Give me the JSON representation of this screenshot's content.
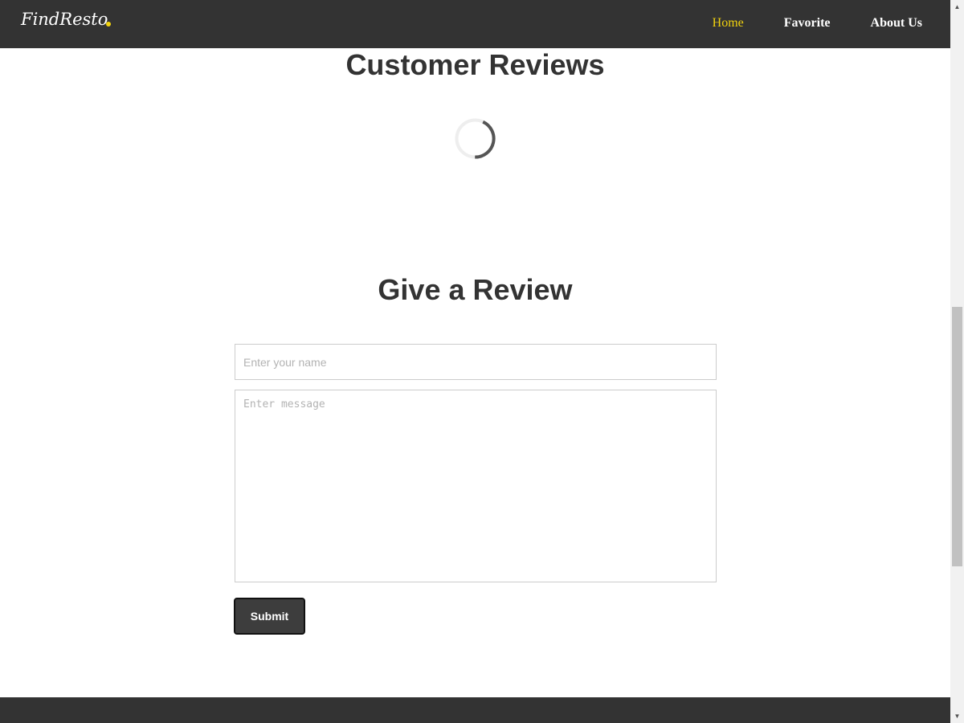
{
  "navbar": {
    "brand": "FindResto",
    "links": [
      {
        "label": "Home",
        "active": true
      },
      {
        "label": "Favorite",
        "active": false
      },
      {
        "label": "About Us",
        "active": false
      }
    ]
  },
  "reviews": {
    "title": "Customer Reviews"
  },
  "review_form": {
    "title": "Give a Review",
    "name_placeholder": "Enter your name",
    "name_value": "",
    "message_placeholder": "Enter message",
    "message_value": "",
    "submit_label": "Submit"
  },
  "icons": {
    "brand_dot": "dot-icon",
    "loader": "loading-spinner-icon",
    "scroll_up": "arrow-up-icon",
    "scroll_down": "arrow-down-icon"
  },
  "colors": {
    "navbar_bg": "#333333",
    "accent": "#f1d20e",
    "text_dark": "#333333",
    "footer_bg": "#333333",
    "button_bg": "#3d3d3d"
  }
}
